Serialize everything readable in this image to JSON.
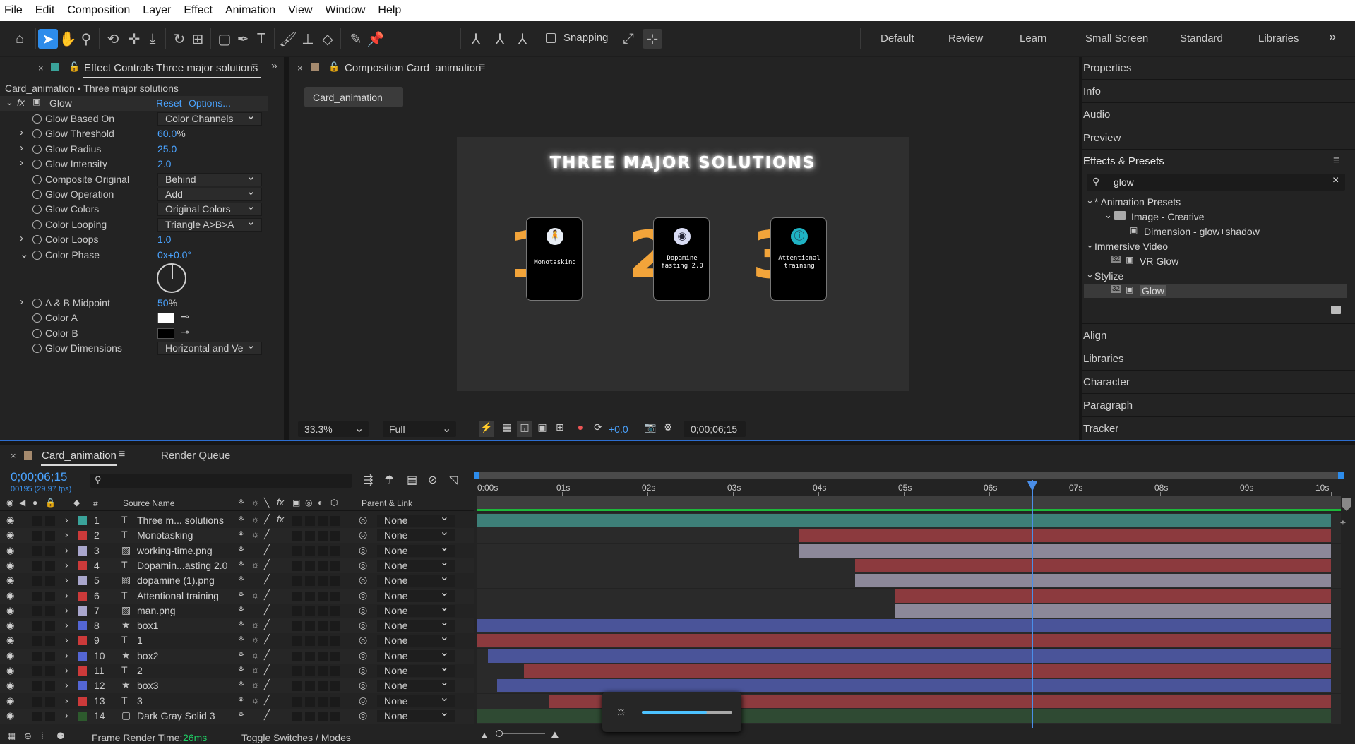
{
  "menu": [
    "File",
    "Edit",
    "Composition",
    "Layer",
    "Effect",
    "Animation",
    "View",
    "Window",
    "Help"
  ],
  "toolbar": {
    "snapping_label": "Snapping"
  },
  "workspaces": [
    "Default",
    "Review",
    "Learn",
    "Small Screen",
    "Standard",
    "Libraries"
  ],
  "effect_controls": {
    "tab_title": "Effect Controls Three major solutions",
    "breadcrumb": "Card_animation • Three major solutions",
    "effect_name": "Glow",
    "reset_label": "Reset",
    "options_label": "Options...",
    "props": [
      {
        "name": "Glow Based On",
        "type": "dropdown",
        "value": "Color Channels"
      },
      {
        "name": "Glow Threshold",
        "type": "number",
        "value": "60.0",
        "unit": "%"
      },
      {
        "name": "Glow Radius",
        "type": "number",
        "value": "25.0",
        "unit": ""
      },
      {
        "name": "Glow Intensity",
        "type": "number",
        "value": "2.0",
        "unit": ""
      },
      {
        "name": "Composite Original",
        "type": "dropdown",
        "value": "Behind"
      },
      {
        "name": "Glow Operation",
        "type": "dropdown",
        "value": "Add"
      },
      {
        "name": "Glow Colors",
        "type": "dropdown",
        "value": "Original Colors"
      },
      {
        "name": "Color Looping",
        "type": "dropdown",
        "value": "Triangle A>B>A"
      },
      {
        "name": "Color Loops",
        "type": "number",
        "value": "1.0",
        "unit": ""
      },
      {
        "name": "Color Phase",
        "type": "number",
        "value": "0x+0.0°",
        "unit": ""
      }
    ],
    "props2": [
      {
        "name": "A & B Midpoint",
        "type": "number",
        "value": "50",
        "unit": "%"
      },
      {
        "name": "Color A",
        "type": "color",
        "value": "#ffffff"
      },
      {
        "name": "Color B",
        "type": "color",
        "value": "#000000"
      },
      {
        "name": "Glow Dimensions",
        "type": "dropdown",
        "value": "Horizontal and Ve"
      }
    ]
  },
  "composition": {
    "tab_title": "Composition Card_animation",
    "sub_tab": "Card_animation",
    "canvas_title": "THREE MAJOR SOLUTIONS",
    "cards": [
      {
        "number": "1",
        "label": "Monotasking"
      },
      {
        "number": "2",
        "label": "Dopamine fasting 2.0"
      },
      {
        "number": "3",
        "label": "Attentional training"
      }
    ],
    "zoom": "33.3%",
    "resolution": "Full",
    "exposure": "+0.0",
    "timecode": "0;00;06;15"
  },
  "right_panel": {
    "items_top": [
      "Properties",
      "Info",
      "Audio",
      "Preview"
    ],
    "effects_presets_title": "Effects & Presets",
    "search_value": "glow",
    "tree": [
      {
        "label": "* Animation Presets",
        "level": 0
      },
      {
        "label": "Image - Creative",
        "level": 1
      },
      {
        "label": "Dimension - glow+shadow",
        "level": 2
      },
      {
        "label": "Immersive Video",
        "level": 0
      },
      {
        "label": "VR Glow",
        "level": 1
      },
      {
        "label": "Stylize",
        "level": 0
      },
      {
        "label": "Glow",
        "level": 1
      }
    ],
    "items_bottom": [
      "Align",
      "Libraries",
      "Character",
      "Paragraph",
      "Tracker"
    ]
  },
  "timeline": {
    "tab_title": "Card_animation",
    "render_queue": "Render Queue",
    "timecode": "0;00;06;15",
    "frame_info": "00195 (29.97 fps)",
    "col_source": "Source Name",
    "col_parent": "Parent & Link",
    "ruler": [
      "0:00s",
      "01s",
      "02s",
      "03s",
      "04s",
      "05s",
      "06s",
      "07s",
      "08s",
      "09s",
      "10s"
    ],
    "playhead_seconds": 6.5,
    "duration_seconds": 10,
    "layers": [
      {
        "num": "1",
        "type": "T",
        "name": "Three m... solutions",
        "label": "#3aa39a",
        "bar": "#3d7f78",
        "start": 0,
        "fx": true
      },
      {
        "num": "2",
        "type": "T",
        "name": "Monotasking",
        "label": "#cc3a3a",
        "bar": "#8c3a3e",
        "start": 3.77
      },
      {
        "num": "3",
        "type": "img",
        "name": "working-time.png",
        "label": "#a9a6cc",
        "bar": "#8c8899",
        "start": 3.77
      },
      {
        "num": "4",
        "type": "T",
        "name": "Dopamin...asting 2.0",
        "label": "#cc3a3a",
        "bar": "#8c3a3e",
        "start": 4.43
      },
      {
        "num": "5",
        "type": "img",
        "name": "dopamine (1).png",
        "label": "#a9a6cc",
        "bar": "#8c8899",
        "start": 4.43
      },
      {
        "num": "6",
        "type": "T",
        "name": "Attentional training",
        "label": "#cc3a3a",
        "bar": "#8c3a3e",
        "start": 4.9
      },
      {
        "num": "7",
        "type": "img",
        "name": "man.png",
        "label": "#a9a6cc",
        "bar": "#8c8899",
        "start": 4.9
      },
      {
        "num": "8",
        "type": "shape",
        "name": "box1",
        "label": "#5466d4",
        "bar": "#4a5499",
        "start": 0
      },
      {
        "num": "9",
        "type": "T",
        "name": "1",
        "label": "#cc3a3a",
        "bar": "#8c3a3e",
        "start": 0
      },
      {
        "num": "10",
        "type": "shape",
        "name": "box2",
        "label": "#5466d4",
        "bar": "#4a5499",
        "start": 0.13
      },
      {
        "num": "11",
        "type": "T",
        "name": "2",
        "label": "#cc3a3a",
        "bar": "#8c3a3e",
        "start": 0.55
      },
      {
        "num": "12",
        "type": "shape",
        "name": "box3",
        "label": "#5466d4",
        "bar": "#4a5499",
        "start": 0.24
      },
      {
        "num": "13",
        "type": "T",
        "name": "3",
        "label": "#cc3a3a",
        "bar": "#8c3a3e",
        "start": 0.85
      },
      {
        "num": "14",
        "type": "solid",
        "name": "Dark Gray Solid 3",
        "label": "#2d5a2d",
        "bar": "#2f4a33",
        "start": 0
      }
    ],
    "parent_value": "None",
    "frame_render_label": "Frame Render Time:",
    "frame_render_value": "26ms",
    "toggle_label": "Toggle Switches / Modes"
  },
  "brightness_level": 0.72
}
